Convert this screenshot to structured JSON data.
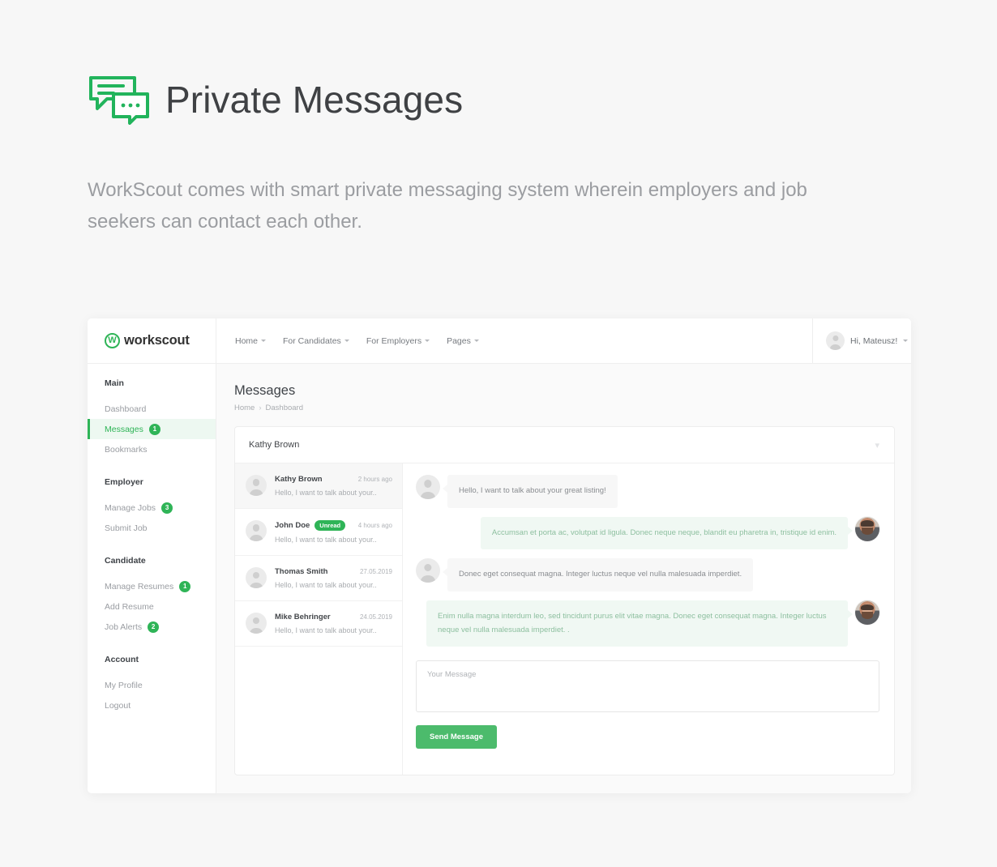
{
  "hero": {
    "icon": "chat-bubbles-icon",
    "title": "Private Messages",
    "subtitle": "WorkScout comes with smart private messaging system wherein employers and job seekers can contact each other.",
    "accent_color": "#22b45c"
  },
  "navbar": {
    "logo_mark": "W",
    "logo_text": "workscout",
    "links": [
      {
        "label": "Home",
        "icon": "chevron-down-icon"
      },
      {
        "label": "For Candidates",
        "icon": "chevron-down-icon"
      },
      {
        "label": "For Employers",
        "icon": "chevron-down-icon"
      },
      {
        "label": "Pages",
        "icon": "chevron-down-icon"
      }
    ],
    "user": {
      "greeting": "Hi, Mateusz!",
      "avatar": "user-avatar",
      "icon": "chevron-down-icon"
    }
  },
  "sidebar": {
    "groups": [
      {
        "heading": "Main",
        "items": [
          {
            "label": "Dashboard",
            "badge": "",
            "active": false
          },
          {
            "label": "Messages",
            "badge": "1",
            "active": true
          },
          {
            "label": "Bookmarks",
            "badge": "",
            "active": false
          }
        ]
      },
      {
        "heading": "Employer",
        "items": [
          {
            "label": "Manage Jobs",
            "badge": "3",
            "active": false
          },
          {
            "label": "Submit Job",
            "badge": "",
            "active": false
          }
        ]
      },
      {
        "heading": "Candidate",
        "items": [
          {
            "label": "Manage Resumes",
            "badge": "1",
            "active": false
          },
          {
            "label": "Add Resume",
            "badge": "",
            "active": false
          },
          {
            "label": "Job Alerts",
            "badge": "2",
            "active": false
          }
        ]
      },
      {
        "heading": "Account",
        "items": [
          {
            "label": "My Profile",
            "badge": "",
            "active": false
          },
          {
            "label": "Logout",
            "badge": "",
            "active": false
          }
        ]
      }
    ]
  },
  "main": {
    "page_title": "Messages",
    "breadcrumb": {
      "items": [
        "Home",
        "Dashboard"
      ],
      "separator": "›"
    },
    "chat_header": {
      "name": "Kathy Brown",
      "icon": "options-icon"
    },
    "threads": [
      {
        "name": "Kathy Brown",
        "time": "2 hours ago",
        "preview": "Hello, I want to talk about your..",
        "unread": "",
        "active": true
      },
      {
        "name": "John Doe",
        "time": "4 hours ago",
        "preview": "Hello, I want to talk about your..",
        "unread": "Unread",
        "active": false
      },
      {
        "name": "Thomas Smith",
        "time": "27.05.2019",
        "preview": "Hello, I want to talk about your..",
        "unread": "",
        "active": false
      },
      {
        "name": "Mike Behringer",
        "time": "24.05.2019",
        "preview": "Hello, I want to talk about your..",
        "unread": "",
        "active": false
      }
    ],
    "messages": [
      {
        "direction": "in",
        "text": "Hello, I want to talk about your great listing!",
        "avatar": "user-avatar"
      },
      {
        "direction": "out",
        "text": "Accumsan et porta ac, volutpat id ligula. Donec neque neque, blandit eu pharetra in, tristique id enim.",
        "avatar": "photo-avatar"
      },
      {
        "direction": "in",
        "text": "Donec eget consequat magna. Integer luctus neque vel nulla malesuada imperdiet.",
        "avatar": "user-avatar"
      },
      {
        "direction": "out",
        "text": "Enim nulla magna interdum leo, sed tincidunt purus elit vitae magna. Donec eget consequat magna. Integer luctus neque vel nulla malesuada imperdiet. .",
        "avatar": "photo-avatar"
      }
    ],
    "compose": {
      "placeholder": "Your Message",
      "value": "",
      "send_label": "Send Message",
      "button_color": "#4cbb6c"
    }
  }
}
